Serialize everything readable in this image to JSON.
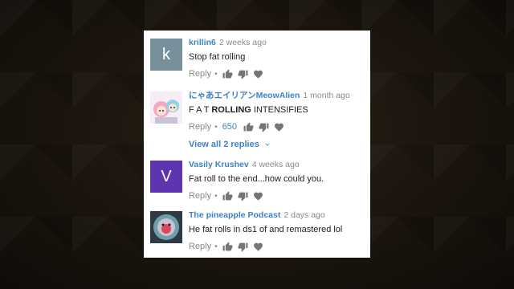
{
  "comments": [
    {
      "avatar_letter": "k",
      "avatar_color": "#78909c",
      "author": "krillin6",
      "time": "2 weeks ago",
      "text": "Stop fat rolling",
      "reply": "Reply",
      "likes": ""
    },
    {
      "avatar_letter": "",
      "avatar_color": "#f3e8f0",
      "author": "にゃあエイリアンMeowAlien",
      "time": "1 month ago",
      "text_prefix": "F A T ",
      "text_bold": "ROLLING",
      "text_suffix": " INTENSIFIES",
      "reply": "Reply",
      "likes": "650",
      "view_replies": "View all 2 replies"
    },
    {
      "avatar_letter": "V",
      "avatar_color": "#5e35b1",
      "author": "Vasily Krushev",
      "time": "4 weeks ago",
      "text": "Fat roll to the end...how could you.",
      "reply": "Reply",
      "likes": ""
    },
    {
      "avatar_letter": "",
      "avatar_color": "#3c4a55",
      "author": "The pineapple Podcast",
      "time": "2 days ago",
      "text": "He fat rolls in ds1 of and remastered lol",
      "reply": "Reply",
      "likes": ""
    }
  ],
  "separator": "•",
  "icons": [
    "thumbs-up-icon",
    "thumbs-down-icon",
    "heart-icon",
    "chevron-down-icon"
  ],
  "colors": {
    "link": "#3d82c9",
    "muted": "#8a8a8a",
    "text": "#222222"
  }
}
